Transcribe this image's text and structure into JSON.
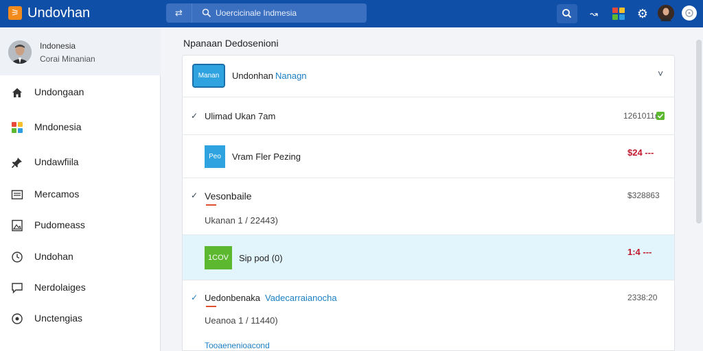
{
  "app": {
    "title": "Undovhan",
    "logo_glyph": "⚞"
  },
  "search": {
    "placeholder": "Uoercicinale Indmesia",
    "swap_glyph": "⇄"
  },
  "toolbar": {
    "forward_glyph": "↝",
    "gear_glyph": "⚙"
  },
  "profile": {
    "name": "Indonesia",
    "subtitle": "Corai Minanian"
  },
  "sidebar": {
    "items": [
      {
        "label": "Undongaan",
        "icon": "home-icon"
      },
      {
        "label": "Mndonesia",
        "icon": "apps-icon"
      },
      {
        "label": "Undawfiila",
        "icon": "pin-icon"
      },
      {
        "label": "Mercamos",
        "icon": "list-icon"
      },
      {
        "label": "Pudomeass",
        "icon": "image-icon"
      },
      {
        "label": "Undohan",
        "icon": "clock-icon"
      },
      {
        "label": "Nerdolaiges",
        "icon": "chat-icon"
      },
      {
        "label": "Unctengias",
        "icon": "settings-icon"
      }
    ]
  },
  "main": {
    "title": "Npanaan Dedosenioni",
    "header": {
      "badge": "Manan",
      "label": "Undonhan",
      "label_accent": "Nanagn",
      "chevron": "˅"
    },
    "rows": [
      {
        "check": "✓",
        "title": "Ulimad Ukan 7am",
        "amount": "1261011r"
      },
      {
        "badge": "Peo",
        "title": "Vram Fler Pezing",
        "amount": "$24 ---"
      },
      {
        "check": "✓",
        "title": "Vesonbaile",
        "sub": "Ukanan 1 / 22443)",
        "amount": "$328863"
      },
      {
        "badge": "1COV",
        "title": "Sip pod (0)",
        "amount": "1:4 ---"
      },
      {
        "check": "✓",
        "title": "Uedonbenaka",
        "title_accent": "Vadecarraianocha",
        "sub": "Ueanoa 1 / 11440)",
        "amount": "2338:20",
        "footer": "Tooaenenioacond"
      }
    ]
  },
  "colors": {
    "topbar": "#0f4fa8",
    "accent": "#1a7fc4",
    "highlight": "#e3f5fc",
    "green": "#5cb82e",
    "red": "#c0182c"
  }
}
